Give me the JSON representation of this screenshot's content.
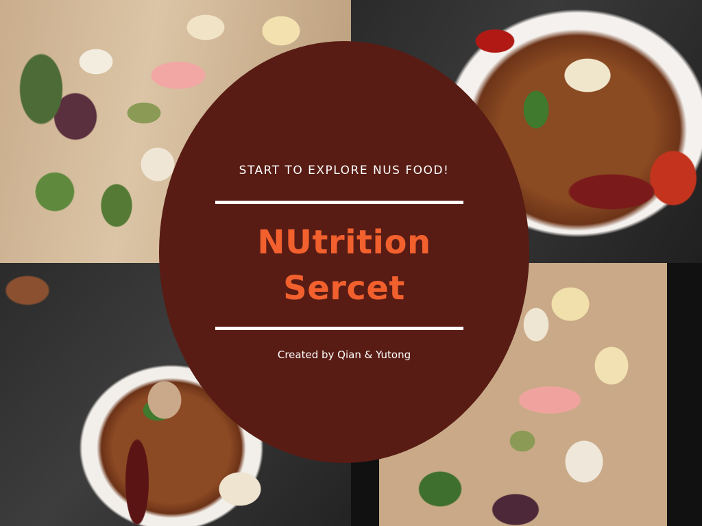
{
  "cover": {
    "subtitle": "START TO EXPLORE NUS FOOD!",
    "title_line1": "NUtrition",
    "title_line2": "Sercet",
    "credit": "Created by Qian & Yutong"
  },
  "colors": {
    "circle": "#581c14",
    "title": "#f2602e",
    "text": "#ffffff"
  }
}
